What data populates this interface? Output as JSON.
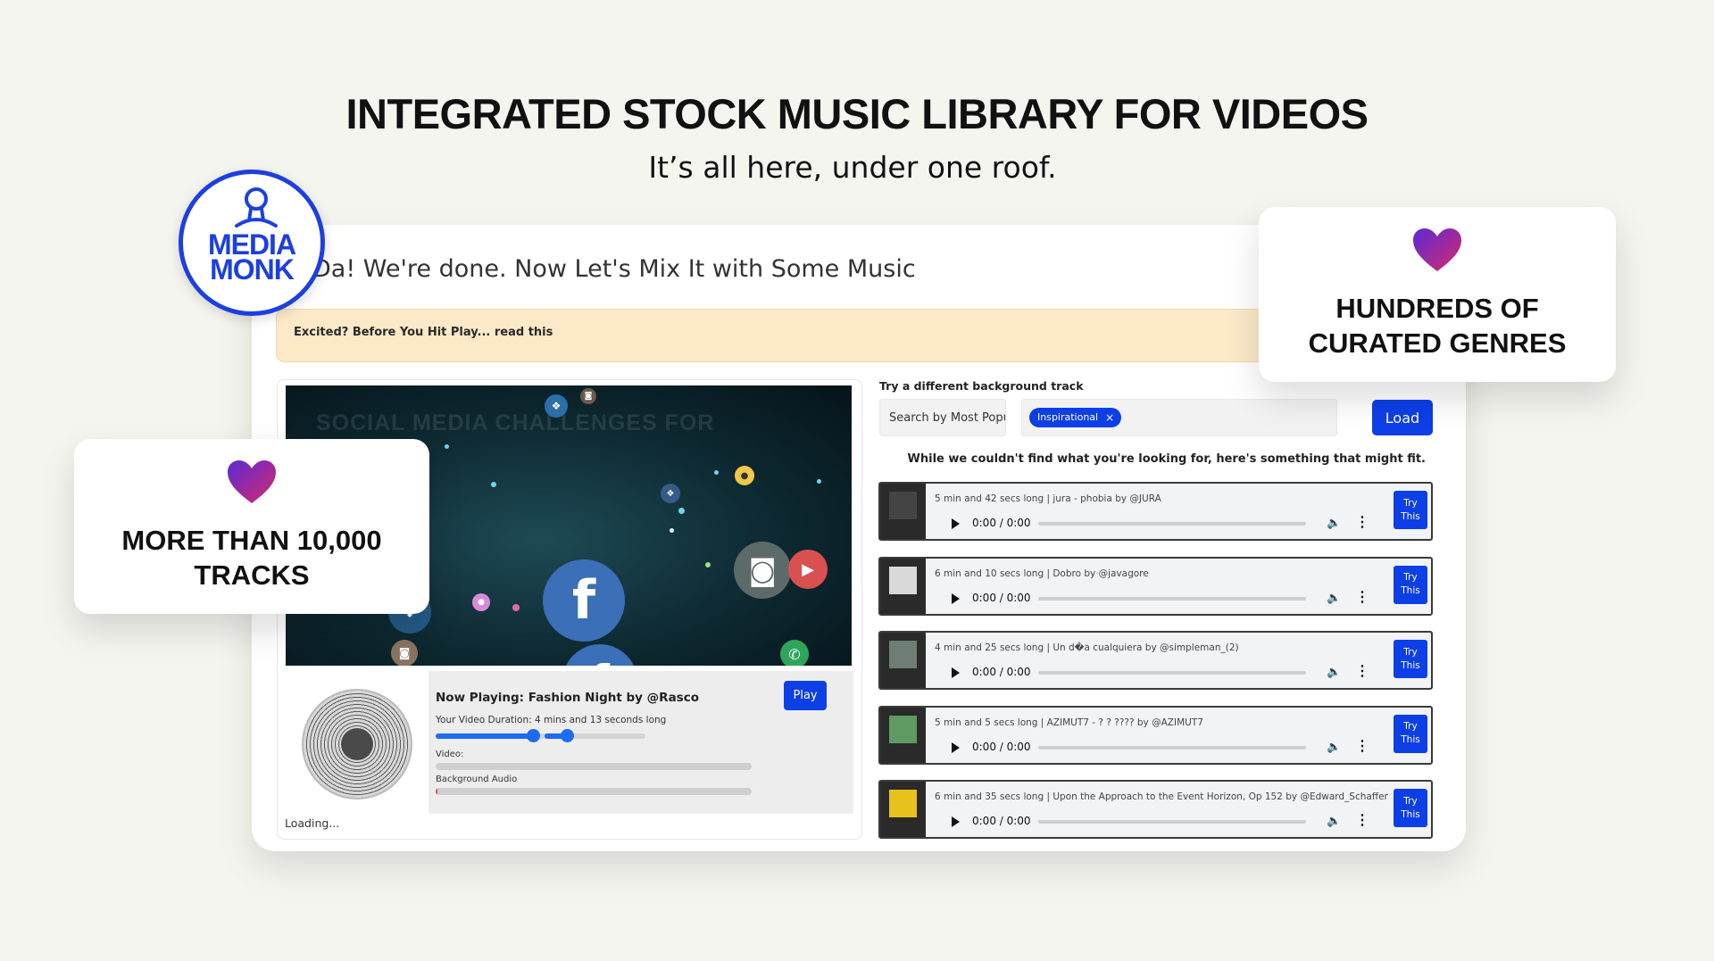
{
  "headline": "INTEGRATED STOCK MUSIC LIBRARY FOR VIDEOS",
  "subline": "It’s all here, under one roof.",
  "logo": {
    "line1": "MEDIA",
    "line2": "MONK"
  },
  "app": {
    "title": "Da! We're done. Now Let's Mix It with Some Music",
    "notice": "Excited? Before You Hit Play... read this",
    "video": {
      "watermark": "SOCIAL MEDIA CHALLENGES FOR"
    },
    "player": {
      "now_playing": "Now Playing: Fashion Night by @Rasco",
      "play_label": "Play",
      "duration": "Your Video Duration: 4 mins and 13 seconds long",
      "video_label": "Video:",
      "audio_label": "Background Audio",
      "audio_progress": 0.005,
      "loading": "Loading..."
    },
    "search": {
      "heading": "Try a different background track",
      "sort_value": "Search by Most Popular",
      "tag": "Inspirational",
      "tag_remove": "×",
      "load_label": "Load",
      "fallback": "While we couldn't find what you're looking for, here's something that might fit."
    },
    "tracks": [
      {
        "title": "5 min and 42 secs long | jura - phobia by @JURA",
        "time": "0:00 / 0:00",
        "try": "Try This",
        "art_color": "#444444"
      },
      {
        "title": "6 min and 10 secs long | Dobro by @javagore",
        "time": "0:00 / 0:00",
        "try": "Try This",
        "art_color": "#d9d9d9"
      },
      {
        "title": "4 min and 25 secs long | Un d�a cualquiera by @simpleman_(2)",
        "time": "0:00 / 0:00",
        "try": "Try This",
        "art_color": "#6f7e74"
      },
      {
        "title": "5 min and 5 secs long | AZIMUT7 - ? ? ???? by @AZIMUT7",
        "time": "0:00 / 0:00",
        "try": "Try This",
        "art_color": "#5e9a62"
      },
      {
        "title": "6 min and 35 secs long | Upon the Approach to the Event Horizon, Op 152 by @Edward_Schaffer",
        "time": "0:00 / 0:00",
        "try": "Try This",
        "art_color": "#e8c21c"
      }
    ]
  },
  "callouts": {
    "tracks": "MORE THAN 10,000 TRACKS",
    "genres": "HUNDREDS OF CURATED GENRES"
  },
  "colors": {
    "accent": "#0d3fe6",
    "logo": "#1d3fe0",
    "notice_bg": "#fbe9c8"
  }
}
